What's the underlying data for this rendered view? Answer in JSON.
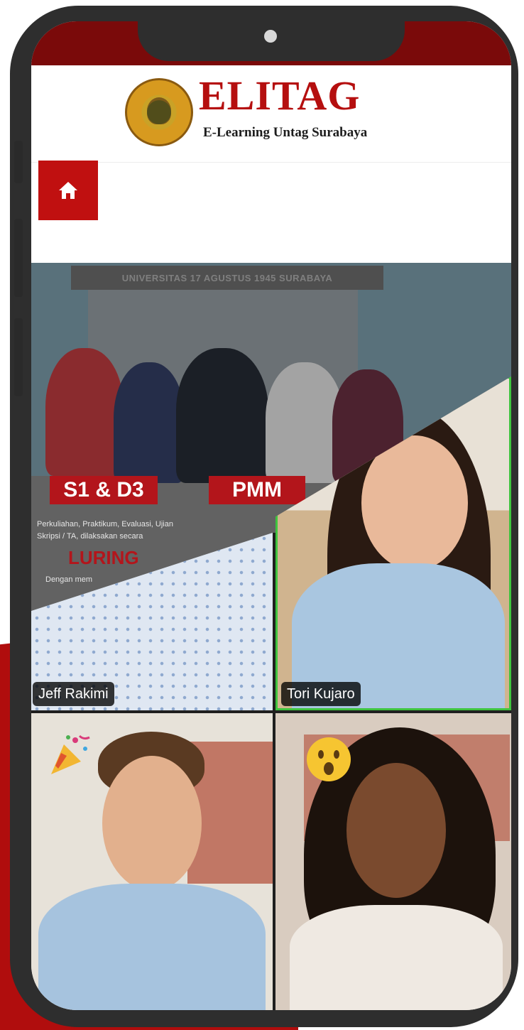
{
  "app": {
    "brand_title": "ELITAG",
    "brand_subtitle": "E-Learning Untag Surabaya"
  },
  "nav": {
    "home_icon": "home-icon"
  },
  "banner": {
    "university": "UNIVERSITAS 17 AGUSTUS 1945 SURABAYA",
    "program_a": "S1 & D3",
    "program_b": "PMM",
    "description": "Perkuliahan, Praktikum, Evaluasi, Ujian Skripsi / TA, dilaksakan secara",
    "mode": "LURING",
    "note": "Dengan mem"
  },
  "video_call": {
    "participants": [
      {
        "name": "Jeff Rakimi"
      },
      {
        "name": "Tori Kujaro",
        "active_speaker": true
      },
      {
        "name": "",
        "reaction": "party-popper-icon"
      },
      {
        "name": "",
        "reaction": "surprised-face-icon"
      }
    ],
    "active_speaker_color": "#3ec43e"
  },
  "colors": {
    "brand_red": "#b50f0f",
    "status_bar": "#7a0a0a",
    "home_button": "#c01010"
  }
}
